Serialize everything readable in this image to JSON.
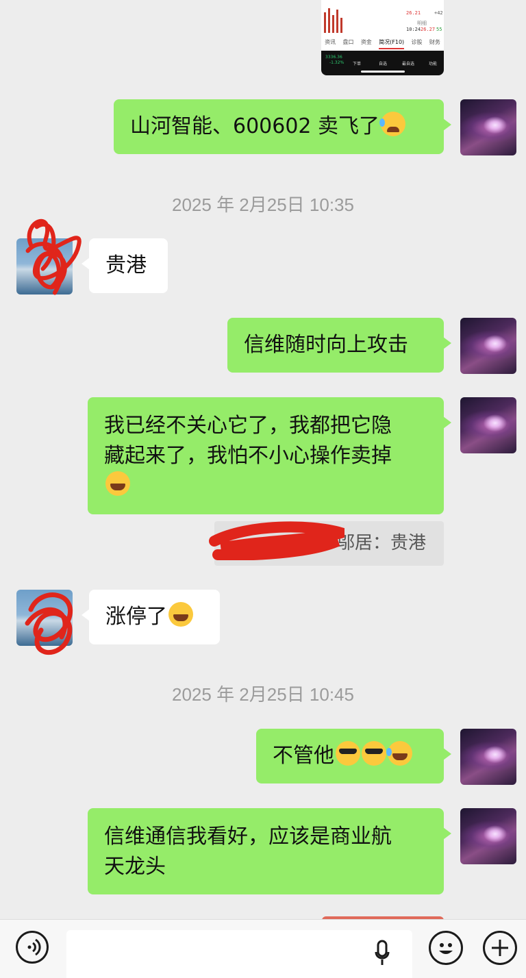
{
  "stock_thumb": {
    "price_top": "26.21",
    "change_top": "+42",
    "mid_label": "明细",
    "time": "10:24",
    "price": "26.27",
    "volume": "55",
    "tabs": [
      "资讯",
      "盘口",
      "资金",
      "简况(F10)",
      "诊股",
      "财务"
    ],
    "active_tab": "简况(F10)",
    "index_value": "3336.36",
    "index_change": "-1.32%",
    "bottom_labels": [
      "下单",
      "自选",
      "最自选",
      "功能"
    ]
  },
  "messages": [
    {
      "id": "m1",
      "side": "out",
      "text": "山河智能、600602 卖飞了",
      "emoji": [
        "crying"
      ]
    },
    {
      "id": "ts1",
      "type": "timestamp",
      "text": "2025 年 2月25日 10:35"
    },
    {
      "id": "m2",
      "side": "in",
      "text": "贵港"
    },
    {
      "id": "m3",
      "side": "out",
      "text": "信维随时向上攻击"
    },
    {
      "id": "m4",
      "side": "out",
      "line1": "我已经不关心它了，我都把它隐",
      "line2": "藏起来了，我怕不小心操作卖掉",
      "emoji": [
        "facepalm"
      ]
    },
    {
      "id": "q1",
      "type": "quote",
      "text": "邬居：贵港"
    },
    {
      "id": "m5",
      "side": "in",
      "text": "涨停了",
      "emoji": [
        "facepalm"
      ]
    },
    {
      "id": "ts2",
      "type": "timestamp",
      "text": "2025 年 2月25日 10:45"
    },
    {
      "id": "m6",
      "side": "out",
      "text": "不管他",
      "emoji": [
        "sunglasses",
        "sunglasses",
        "tears-of-joy"
      ]
    },
    {
      "id": "m7",
      "side": "out",
      "line1": "信维通信我看好，应该是商业航",
      "line2": "天龙头"
    }
  ],
  "input_bar": {
    "voice_icon": "voice-icon",
    "mic_icon": "mic-icon",
    "emoji_icon": "emoji-icon",
    "plus_icon": "plus-icon"
  },
  "colors": {
    "background": "#ededed",
    "outgoing_bubble": "#95ec69",
    "incoming_bubble": "#ffffff",
    "timestamp_text": "#9b9b9b",
    "redaction": "#e0251b"
  }
}
